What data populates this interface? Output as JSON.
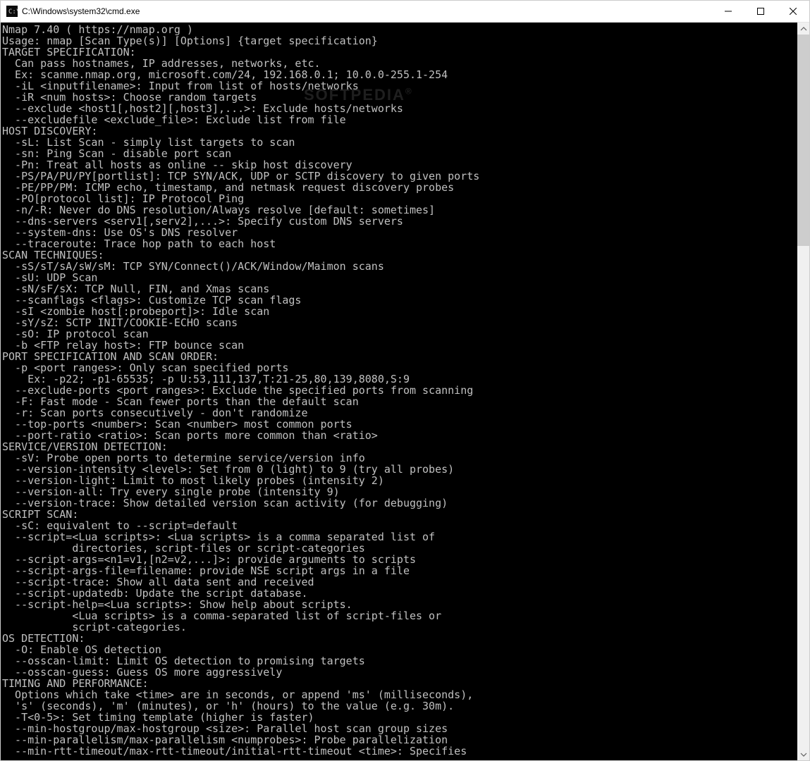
{
  "window": {
    "title": "C:\\Windows\\system32\\cmd.exe"
  },
  "watermark": "SOFTPEDIA",
  "watermark_reg": "®",
  "console": {
    "lines": [
      "Nmap 7.40 ( https://nmap.org )",
      "Usage: nmap [Scan Type(s)] [Options] {target specification}",
      "TARGET SPECIFICATION:",
      "  Can pass hostnames, IP addresses, networks, etc.",
      "  Ex: scanme.nmap.org, microsoft.com/24, 192.168.0.1; 10.0.0-255.1-254",
      "  -iL <inputfilename>: Input from list of hosts/networks",
      "  -iR <num hosts>: Choose random targets",
      "  --exclude <host1[,host2][,host3],...>: Exclude hosts/networks",
      "  --excludefile <exclude_file>: Exclude list from file",
      "HOST DISCOVERY:",
      "  -sL: List Scan - simply list targets to scan",
      "  -sn: Ping Scan - disable port scan",
      "  -Pn: Treat all hosts as online -- skip host discovery",
      "  -PS/PA/PU/PY[portlist]: TCP SYN/ACK, UDP or SCTP discovery to given ports",
      "  -PE/PP/PM: ICMP echo, timestamp, and netmask request discovery probes",
      "  -PO[protocol list]: IP Protocol Ping",
      "  -n/-R: Never do DNS resolution/Always resolve [default: sometimes]",
      "  --dns-servers <serv1[,serv2],...>: Specify custom DNS servers",
      "  --system-dns: Use OS's DNS resolver",
      "  --traceroute: Trace hop path to each host",
      "SCAN TECHNIQUES:",
      "  -sS/sT/sA/sW/sM: TCP SYN/Connect()/ACK/Window/Maimon scans",
      "  -sU: UDP Scan",
      "  -sN/sF/sX: TCP Null, FIN, and Xmas scans",
      "  --scanflags <flags>: Customize TCP scan flags",
      "  -sI <zombie host[:probeport]>: Idle scan",
      "  -sY/sZ: SCTP INIT/COOKIE-ECHO scans",
      "  -sO: IP protocol scan",
      "  -b <FTP relay host>: FTP bounce scan",
      "PORT SPECIFICATION AND SCAN ORDER:",
      "  -p <port ranges>: Only scan specified ports",
      "    Ex: -p22; -p1-65535; -p U:53,111,137,T:21-25,80,139,8080,S:9",
      "  --exclude-ports <port ranges>: Exclude the specified ports from scanning",
      "  -F: Fast mode - Scan fewer ports than the default scan",
      "  -r: Scan ports consecutively - don't randomize",
      "  --top-ports <number>: Scan <number> most common ports",
      "  --port-ratio <ratio>: Scan ports more common than <ratio>",
      "SERVICE/VERSION DETECTION:",
      "  -sV: Probe open ports to determine service/version info",
      "  --version-intensity <level>: Set from 0 (light) to 9 (try all probes)",
      "  --version-light: Limit to most likely probes (intensity 2)",
      "  --version-all: Try every single probe (intensity 9)",
      "  --version-trace: Show detailed version scan activity (for debugging)",
      "SCRIPT SCAN:",
      "  -sC: equivalent to --script=default",
      "  --script=<Lua scripts>: <Lua scripts> is a comma separated list of",
      "           directories, script-files or script-categories",
      "  --script-args=<n1=v1,[n2=v2,...]>: provide arguments to scripts",
      "  --script-args-file=filename: provide NSE script args in a file",
      "  --script-trace: Show all data sent and received",
      "  --script-updatedb: Update the script database.",
      "  --script-help=<Lua scripts>: Show help about scripts.",
      "           <Lua scripts> is a comma-separated list of script-files or",
      "           script-categories.",
      "OS DETECTION:",
      "  -O: Enable OS detection",
      "  --osscan-limit: Limit OS detection to promising targets",
      "  --osscan-guess: Guess OS more aggressively",
      "TIMING AND PERFORMANCE:",
      "  Options which take <time> are in seconds, or append 'ms' (milliseconds),",
      "  's' (seconds), 'm' (minutes), or 'h' (hours) to the value (e.g. 30m).",
      "  -T<0-5>: Set timing template (higher is faster)",
      "  --min-hostgroup/max-hostgroup <size>: Parallel host scan group sizes",
      "  --min-parallelism/max-parallelism <numprobes>: Probe parallelization",
      "  --min-rtt-timeout/max-rtt-timeout/initial-rtt-timeout <time>: Specifies"
    ]
  }
}
